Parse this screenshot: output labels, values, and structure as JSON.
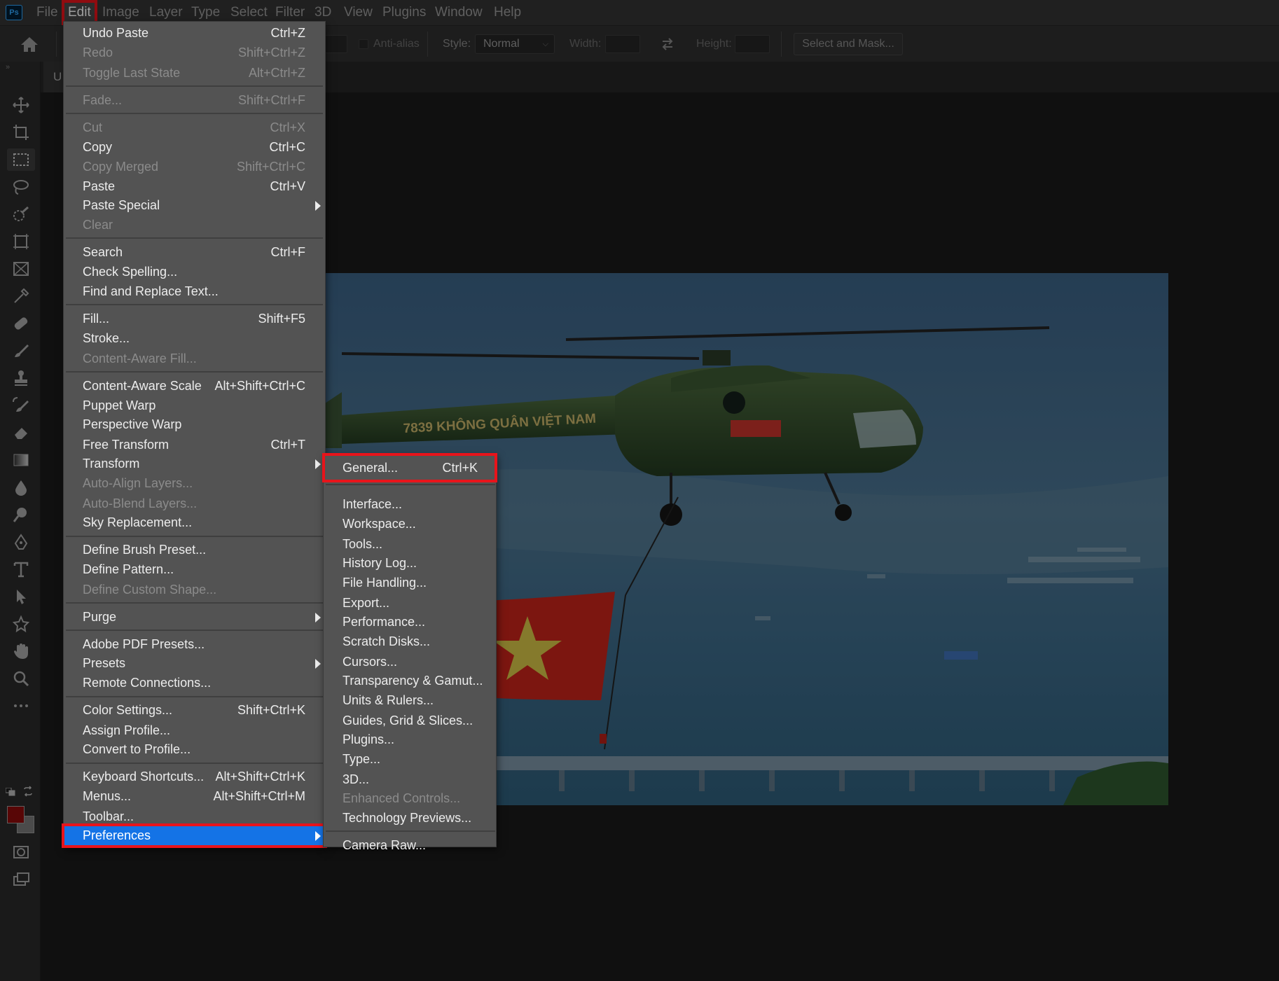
{
  "app": {
    "logo_text": "Ps"
  },
  "menubar": {
    "items": [
      {
        "label": "File"
      },
      {
        "label": "Edit"
      },
      {
        "label": "Image"
      },
      {
        "label": "Layer"
      },
      {
        "label": "Type"
      },
      {
        "label": "Select"
      },
      {
        "label": "Filter"
      },
      {
        "label": "3D"
      },
      {
        "label": "View"
      },
      {
        "label": "Plugins"
      },
      {
        "label": "Window"
      },
      {
        "label": "Help"
      }
    ]
  },
  "options": {
    "anti_alias_label": "Anti-alias",
    "style_label": "Style:",
    "style_value": "Normal",
    "width_label": "Width:",
    "height_label": "Height:",
    "select_and_mask_label": "Select and Mask..."
  },
  "document": {
    "tab_label": "U"
  },
  "colors": {
    "foreground": "#8e0a0a",
    "background": "#7a7a7a",
    "highlight": "#1473e6",
    "annotation": "#e8141b"
  },
  "edit_menu": {
    "items": [
      {
        "label": "Undo Paste",
        "shortcut": "Ctrl+Z"
      },
      {
        "label": "Redo",
        "shortcut": "Shift+Ctrl+Z"
      },
      {
        "label": "Toggle Last State",
        "shortcut": "Alt+Ctrl+Z"
      },
      {
        "label": "Fade...",
        "shortcut": "Shift+Ctrl+F"
      },
      {
        "label": "Cut",
        "shortcut": "Ctrl+X"
      },
      {
        "label": "Copy",
        "shortcut": "Ctrl+C"
      },
      {
        "label": "Copy Merged",
        "shortcut": "Shift+Ctrl+C"
      },
      {
        "label": "Paste",
        "shortcut": "Ctrl+V"
      },
      {
        "label": "Paste Special",
        "shortcut": ""
      },
      {
        "label": "Clear",
        "shortcut": ""
      },
      {
        "label": "Search",
        "shortcut": "Ctrl+F"
      },
      {
        "label": "Check Spelling...",
        "shortcut": ""
      },
      {
        "label": "Find and Replace Text...",
        "shortcut": ""
      },
      {
        "label": "Fill...",
        "shortcut": "Shift+F5"
      },
      {
        "label": "Stroke...",
        "shortcut": ""
      },
      {
        "label": "Content-Aware Fill...",
        "shortcut": ""
      },
      {
        "label": "Content-Aware Scale",
        "shortcut": "Alt+Shift+Ctrl+C"
      },
      {
        "label": "Puppet Warp",
        "shortcut": ""
      },
      {
        "label": "Perspective Warp",
        "shortcut": ""
      },
      {
        "label": "Free Transform",
        "shortcut": "Ctrl+T"
      },
      {
        "label": "Transform",
        "shortcut": ""
      },
      {
        "label": "Auto-Align Layers...",
        "shortcut": ""
      },
      {
        "label": "Auto-Blend Layers...",
        "shortcut": ""
      },
      {
        "label": "Sky Replacement...",
        "shortcut": ""
      },
      {
        "label": "Define Brush Preset...",
        "shortcut": ""
      },
      {
        "label": "Define Pattern...",
        "shortcut": ""
      },
      {
        "label": "Define Custom Shape...",
        "shortcut": ""
      },
      {
        "label": "Purge",
        "shortcut": ""
      },
      {
        "label": "Adobe PDF Presets...",
        "shortcut": ""
      },
      {
        "label": "Presets",
        "shortcut": ""
      },
      {
        "label": "Remote Connections...",
        "shortcut": ""
      },
      {
        "label": "Color Settings...",
        "shortcut": "Shift+Ctrl+K"
      },
      {
        "label": "Assign Profile...",
        "shortcut": ""
      },
      {
        "label": "Convert to Profile...",
        "shortcut": ""
      },
      {
        "label": "Keyboard Shortcuts...",
        "shortcut": "Alt+Shift+Ctrl+K"
      },
      {
        "label": "Menus...",
        "shortcut": "Alt+Shift+Ctrl+M"
      },
      {
        "label": "Toolbar...",
        "shortcut": ""
      },
      {
        "label": "Preferences",
        "shortcut": ""
      }
    ]
  },
  "preferences_menu": {
    "items": [
      {
        "label": "General...",
        "shortcut": "Ctrl+K"
      },
      {
        "label": "Interface..."
      },
      {
        "label": "Workspace..."
      },
      {
        "label": "Tools..."
      },
      {
        "label": "History Log..."
      },
      {
        "label": "File Handling..."
      },
      {
        "label": "Export..."
      },
      {
        "label": "Performance..."
      },
      {
        "label": "Scratch Disks..."
      },
      {
        "label": "Cursors..."
      },
      {
        "label": "Transparency & Gamut..."
      },
      {
        "label": "Units & Rulers..."
      },
      {
        "label": "Guides, Grid & Slices..."
      },
      {
        "label": "Plugins..."
      },
      {
        "label": "Type..."
      },
      {
        "label": "3D..."
      },
      {
        "label": "Enhanced Controls..."
      },
      {
        "label": "Technology Previews..."
      },
      {
        "label": "Camera Raw..."
      }
    ]
  },
  "image": {
    "helicopter_text": "7839 KHÔNG QUÂN VIỆT NAM"
  }
}
